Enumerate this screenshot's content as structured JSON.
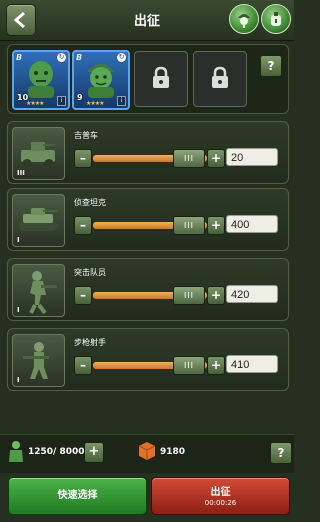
{
  "header": {
    "title": "出征"
  },
  "heroes": [
    {
      "level": "10"
    },
    {
      "level": "9"
    }
  ],
  "help_label": "?",
  "units": [
    {
      "name": "吉普车",
      "rank": "III",
      "quantity": "20"
    },
    {
      "name": "侦查坦克",
      "rank": "I",
      "quantity": "400"
    },
    {
      "name": "突击队员",
      "rank": "I",
      "quantity": "420"
    },
    {
      "name": "步枪射手",
      "rank": "I",
      "quantity": "410"
    }
  ],
  "slider_thumb_label": "III",
  "minus_label": "–",
  "plus_label": "+",
  "capacity": {
    "current": "1250",
    "max": "8000",
    "display": "1250/ 8000"
  },
  "bricks": "9180",
  "buttons": {
    "quick_select": "快速选择",
    "deploy": "出征",
    "timer": "00:00:26"
  },
  "colors": {
    "quick_select": "#2f9a30",
    "deploy": "#b8372a",
    "slider": "#e69a45",
    "hero_frame": "#5fa3e8"
  }
}
